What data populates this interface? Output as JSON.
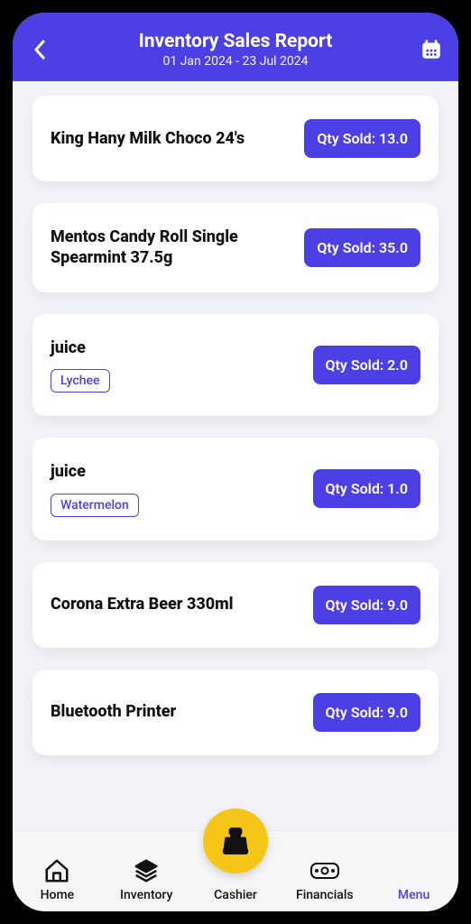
{
  "header": {
    "title": "Inventory Sales Report",
    "date_range": "01 Jan 2024 - 23 Jul 2024"
  },
  "qty_prefix": "Qty Sold: ",
  "items": [
    {
      "name": "King Hany Milk Choco 24's",
      "variant": null,
      "qty": "13.0"
    },
    {
      "name": "Mentos Candy Roll Single Spearmint 37.5g",
      "variant": null,
      "qty": "35.0"
    },
    {
      "name": "juice",
      "variant": "Lychee",
      "qty": "2.0"
    },
    {
      "name": "juice",
      "variant": "Watermelon",
      "qty": "1.0"
    },
    {
      "name": "Corona Extra Beer  330ml",
      "variant": null,
      "qty": "9.0"
    },
    {
      "name": "Bluetooth Printer",
      "variant": null,
      "qty": "9.0"
    }
  ],
  "nav": {
    "home": "Home",
    "inventory": "Inventory",
    "cashier": "Cashier",
    "financials": "Financials",
    "menu": "Menu"
  }
}
